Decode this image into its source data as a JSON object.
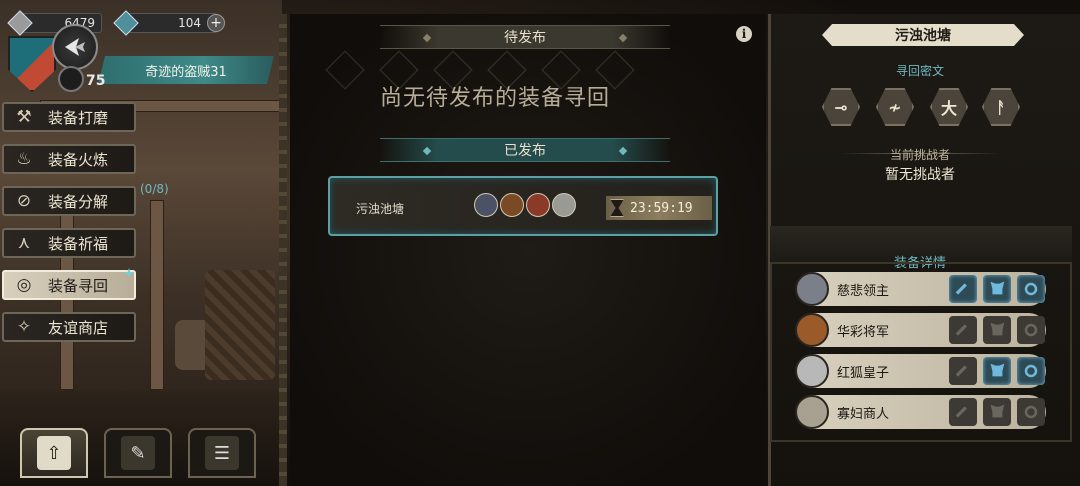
{
  "resources": [
    {
      "name": "silver",
      "value": "6479"
    },
    {
      "name": "gems",
      "value": "104"
    }
  ],
  "player": {
    "name": "奇迹的盗贼31",
    "level": "75"
  },
  "menu": {
    "items": [
      {
        "id": "grind",
        "label": "装备打磨",
        "icon": "hammer-icon"
      },
      {
        "id": "forge",
        "label": "装备火炼",
        "icon": "flame-icon"
      },
      {
        "id": "split",
        "label": "装备分解",
        "icon": "split-icon"
      },
      {
        "id": "bless",
        "label": "装备祈福",
        "icon": "pray-icon"
      },
      {
        "id": "recall",
        "label": "装备寻回",
        "icon": "spiral-icon",
        "active": true
      },
      {
        "id": "shop",
        "label": "友谊商店",
        "icon": "fox-icon"
      }
    ],
    "split_count": "(0/8)"
  },
  "middle": {
    "pending_header": "待发布",
    "empty_message": "尚无待发布的装备寻回",
    "published_header": "已发布",
    "posted": {
      "name": "污浊池塘",
      "timer": "23:59:19"
    }
  },
  "right": {
    "title": "污浊池塘",
    "runes_label": "寻回密文",
    "runes": [
      "⊸",
      "≁",
      "大",
      "ᚨ"
    ],
    "challenger_label": "当前挑战者",
    "challenger_value": "暂无挑战者",
    "details_label": "装备详情",
    "equipment": [
      {
        "name": "慈悲领主",
        "color": "#7a7f8a",
        "slots": [
          true,
          true,
          true
        ]
      },
      {
        "name": "华彩将军",
        "color": "#9a5a2a",
        "slots": [
          false,
          false,
          false
        ]
      },
      {
        "name": "红狐皇子",
        "color": "#b8b8b8",
        "slots": [
          false,
          true,
          true
        ]
      },
      {
        "name": "寡妇商人",
        "color": "#a8a090",
        "slots": [
          false,
          false,
          false
        ]
      }
    ]
  },
  "colors": {
    "accent_teal": "#6fb9c0",
    "lit_slot": "#6fb9dc"
  }
}
